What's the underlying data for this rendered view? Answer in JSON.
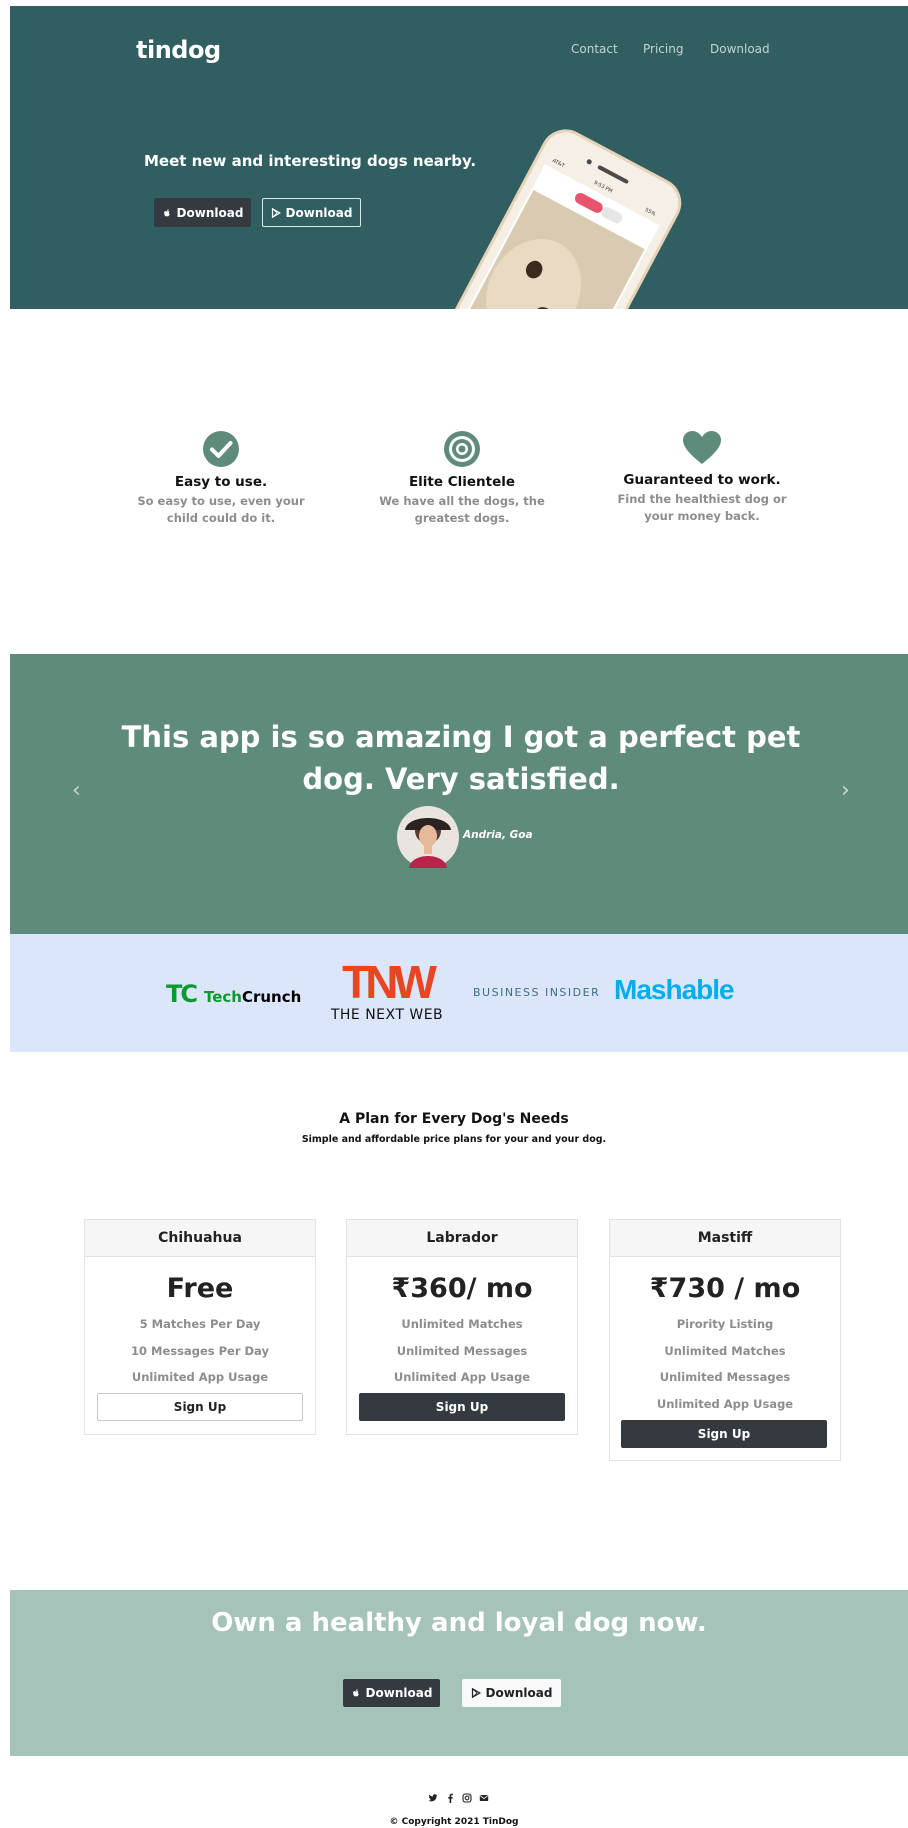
{
  "brand": "tindog",
  "nav": [
    "Contact",
    "Pricing",
    "Download"
  ],
  "hero": {
    "headline": "Meet new and interesting dogs nearby.",
    "apple_download": "Download",
    "google_download": "Download",
    "phone": {
      "carrier": "AT&T",
      "time": "9:53 PM",
      "battery": "55%"
    }
  },
  "features": [
    {
      "icon": "check-circle-icon",
      "title": "Easy to use.",
      "text": "So easy to use, even your child could do it."
    },
    {
      "icon": "bullseye-icon",
      "title": "Elite Clientele",
      "text": "We have all the dogs, the greatest dogs."
    },
    {
      "icon": "heart-icon",
      "title": "Guaranteed to work.",
      "text": "Find the healthiest dog or your money back."
    }
  ],
  "testimonial": {
    "quote": "This app is so amazing I got a perfect pet dog. Very satisfied.",
    "author": "Andria, Goa"
  },
  "press": {
    "techcrunch_mark": "TC",
    "techcrunch_tech": "Tech",
    "techcrunch_crunch": "Crunch",
    "tnw_mark": "TNW",
    "tnw_name": "THE NEXT WEB",
    "business_insider": "BUSINESS INSIDER",
    "mashable": "Mashable"
  },
  "pricing": {
    "title": "A Plan for Every Dog's Needs",
    "subtitle": "Simple and affordable price plans for your and your dog.",
    "plans": [
      {
        "name": "Chihuahua",
        "price": "Free",
        "features": [
          "5 Matches Per Day",
          "10 Messages Per Day",
          "Unlimited App Usage"
        ],
        "cta": "Sign Up"
      },
      {
        "name": "Labrador",
        "price": "₹360/ mo",
        "features": [
          "Unlimited Matches",
          "Unlimited Messages",
          "Unlimited App Usage"
        ],
        "cta": "Sign Up"
      },
      {
        "name": "Mastiff",
        "price": "₹730 / mo",
        "features": [
          "Pirority Listing",
          "Unlimited Matches",
          "Unlimited Messages",
          "Unlimited App Usage"
        ],
        "cta": "Sign Up"
      }
    ]
  },
  "cta": {
    "title": "Own a healthy and loyal dog now.",
    "apple_download": "Download",
    "google_download": "Download"
  },
  "footer": {
    "icons": [
      "twitter-icon",
      "facebook-icon",
      "instagram-icon",
      "envelope-icon"
    ],
    "copyright": "© Copyright 2021 TinDog"
  },
  "colors": {
    "hero_bg": "#305e61",
    "testimonial_bg": "#5f8b7b",
    "press_bg": "#dce6fb",
    "cta_bg": "#a6c3ba",
    "feature_icon": "#5f8b7b",
    "dark_button": "#343a40"
  }
}
